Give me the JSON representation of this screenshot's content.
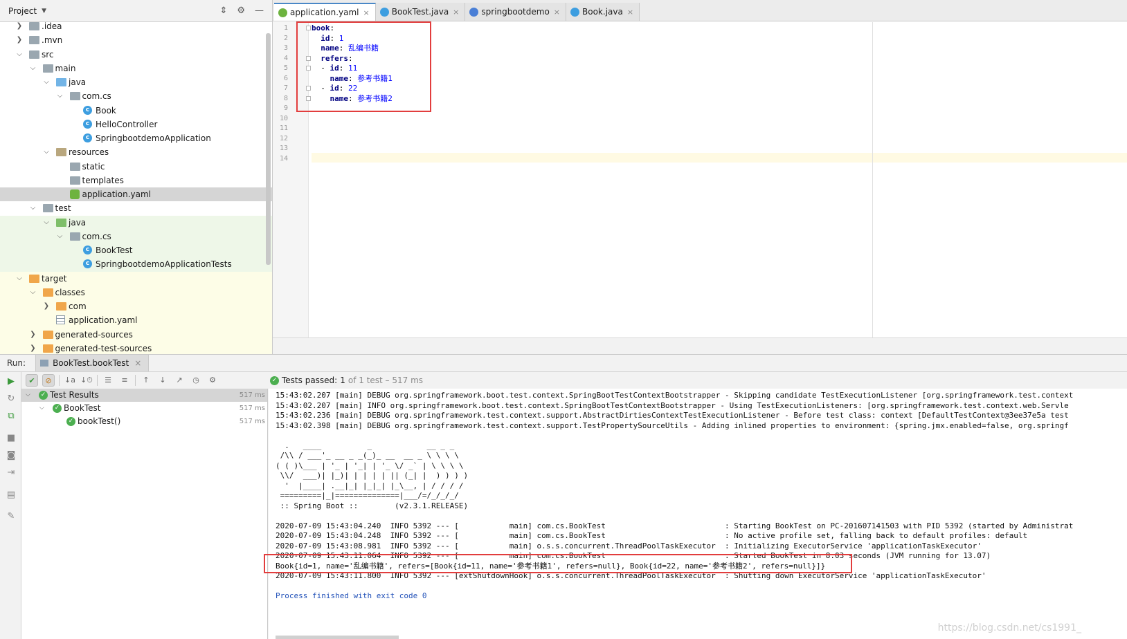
{
  "project_panel": {
    "title": "Project",
    "tree": [
      {
        "label": ".idea",
        "depth": 1,
        "arrow": "›",
        "icon": "folder"
      },
      {
        "label": ".mvn",
        "depth": 1,
        "arrow": "›",
        "icon": "folder"
      },
      {
        "label": "src",
        "depth": 1,
        "arrow": "⌄",
        "icon": "folder"
      },
      {
        "label": "main",
        "depth": 2,
        "arrow": "⌄",
        "icon": "folder"
      },
      {
        "label": "java",
        "depth": 3,
        "arrow": "⌄",
        "icon": "folder-blue"
      },
      {
        "label": "com.cs",
        "depth": 4,
        "arrow": "⌄",
        "icon": "folder"
      },
      {
        "label": "Book",
        "depth": 5,
        "arrow": "",
        "icon": "class"
      },
      {
        "label": "HelloController",
        "depth": 5,
        "arrow": "",
        "icon": "class"
      },
      {
        "label": "SpringbootdemoApplication",
        "depth": 5,
        "arrow": "",
        "icon": "class"
      },
      {
        "label": "resources",
        "depth": 3,
        "arrow": "⌄",
        "icon": "folder-res"
      },
      {
        "label": "static",
        "depth": 4,
        "arrow": "",
        "icon": "folder"
      },
      {
        "label": "templates",
        "depth": 4,
        "arrow": "",
        "icon": "folder"
      },
      {
        "label": "application.yaml",
        "depth": 4,
        "arrow": "",
        "icon": "yaml",
        "selected": true
      },
      {
        "label": "test",
        "depth": 2,
        "arrow": "⌄",
        "icon": "folder"
      },
      {
        "label": "java",
        "depth": 3,
        "arrow": "⌄",
        "icon": "folder-green",
        "bg": "test"
      },
      {
        "label": "com.cs",
        "depth": 4,
        "arrow": "⌄",
        "icon": "folder",
        "bg": "test"
      },
      {
        "label": "BookTest",
        "depth": 5,
        "arrow": "",
        "icon": "class",
        "bg": "test"
      },
      {
        "label": "SpringbootdemoApplicationTests",
        "depth": 5,
        "arrow": "",
        "icon": "class",
        "bg": "test"
      },
      {
        "label": "target",
        "depth": 1,
        "arrow": "⌄",
        "icon": "folder-orange",
        "bg": "target"
      },
      {
        "label": "classes",
        "depth": 2,
        "arrow": "⌄",
        "icon": "folder-orange",
        "bg": "target"
      },
      {
        "label": "com",
        "depth": 3,
        "arrow": "›",
        "icon": "folder-orange",
        "bg": "target"
      },
      {
        "label": "application.yaml",
        "depth": 3,
        "arrow": "",
        "icon": "yaml-file",
        "bg": "target"
      },
      {
        "label": "generated-sources",
        "depth": 2,
        "arrow": "›",
        "icon": "folder-orange",
        "bg": "target"
      },
      {
        "label": "generated-test-sources",
        "depth": 2,
        "arrow": "›",
        "icon": "folder-orange",
        "bg": "target"
      }
    ]
  },
  "editor": {
    "tabs": [
      {
        "label": "application.yaml",
        "active": true,
        "icon_color": "#6db33f"
      },
      {
        "label": "BookTest.java",
        "active": false,
        "icon_color": "#3d9ee0"
      },
      {
        "label": "springbootdemo",
        "active": false,
        "icon_color": "#4a7fd6"
      },
      {
        "label": "Book.java",
        "active": false,
        "icon_color": "#3d9ee0"
      }
    ],
    "line_numbers": [
      "1",
      "2",
      "3",
      "4",
      "5",
      "6",
      "7",
      "8",
      "9",
      "10",
      "11",
      "12",
      "13",
      "14"
    ],
    "code_lines": [
      {
        "indent": "",
        "key": "book",
        "sep": ":",
        "value": ""
      },
      {
        "indent": "  ",
        "key": "id",
        "sep": ": ",
        "value": "1"
      },
      {
        "indent": "  ",
        "key": "name",
        "sep": ": ",
        "value": "乱编书籍"
      },
      {
        "indent": "  ",
        "key": "refers",
        "sep": ":",
        "value": ""
      },
      {
        "indent": "  - ",
        "key": "id",
        "sep": ": ",
        "value": "11"
      },
      {
        "indent": "    ",
        "key": "name",
        "sep": ": ",
        "value": "参考书籍1"
      },
      {
        "indent": "  - ",
        "key": "id",
        "sep": ": ",
        "value": "22"
      },
      {
        "indent": "    ",
        "key": "name",
        "sep": ": ",
        "value": "参考书籍2"
      }
    ]
  },
  "run": {
    "label": "Run:",
    "tab_label": "BookTest.bookTest",
    "status": {
      "passed": "Tests passed:",
      "count": "1",
      "rest": "of 1 test – 517 ms"
    },
    "tests": [
      {
        "label": "Test Results",
        "ms": "517 ms",
        "depth": 0,
        "arrow": "⌄",
        "selected": true
      },
      {
        "label": "BookTest",
        "ms": "517 ms",
        "depth": 1,
        "arrow": "⌄",
        "selected": false
      },
      {
        "label": "bookTest()",
        "ms": "517 ms",
        "depth": 2,
        "arrow": "",
        "selected": false
      }
    ],
    "console_lines": [
      "15:43:02.207 [main] DEBUG org.springframework.boot.test.context.SpringBootTestContextBootstrapper - Skipping candidate TestExecutionListener [org.springframework.test.context",
      "15:43:02.207 [main] INFO org.springframework.boot.test.context.SpringBootTestContextBootstrapper - Using TestExecutionListeners: [org.springframework.test.context.web.Servle",
      "15:43:02.236 [main] DEBUG org.springframework.test.context.support.AbstractDirtiesContextTestExecutionListener - Before test class: context [DefaultTestContext@3ee37e5a test",
      "15:43:02.398 [main] DEBUG org.springframework.test.context.support.TestPropertySourceUtils - Adding inlined properties to environment: {spring.jmx.enabled=false, org.springf",
      "",
      "  .   ____          _            __ _ _",
      " /\\\\ / ___'_ __ _ _(_)_ __  __ _ \\ \\ \\ \\",
      "( ( )\\___ | '_ | '_| | '_ \\/ _` | \\ \\ \\ \\",
      " \\\\/  ___)| |_)| | | | | || (_| |  ) ) ) )",
      "  '  |____| .__|_| |_|_| |_\\__, | / / / /",
      " =========|_|==============|___/=/_/_/_/",
      " :: Spring Boot ::        (v2.3.1.RELEASE)",
      "",
      "2020-07-09 15:43:04.240  INFO 5392 --- [           main] com.cs.BookTest                          : Starting BookTest on PC-201607141503 with PID 5392 (started by Administrat",
      "2020-07-09 15:43:04.248  INFO 5392 --- [           main] com.cs.BookTest                          : No active profile set, falling back to default profiles: default",
      "2020-07-09 15:43:08.981  INFO 5392 --- [           main] o.s.s.concurrent.ThreadPoolTaskExecutor  : Initializing ExecutorService 'applicationTaskExecutor'",
      "2020-07-09 15:43:11.064  INFO 5392 --- [           main] com.cs.BookTest                          : Started BookTest in 8.03 seconds (JVM running for 13.07)",
      "Book{id=1, name='乱编书籍', refers=[Book{id=11, name='参考书籍1', refers=null}, Book{id=22, name='参考书籍2', refers=null}]}",
      "2020-07-09 15:43:11.800  INFO 5392 --- [extShutdownHook] o.s.s.concurrent.ThreadPoolTaskExecutor  : Shutting down ExecutorService 'applicationTaskExecutor'",
      "",
      "Process finished with exit code 0"
    ]
  },
  "watermark": "https://blog.csdn.net/cs1991_"
}
